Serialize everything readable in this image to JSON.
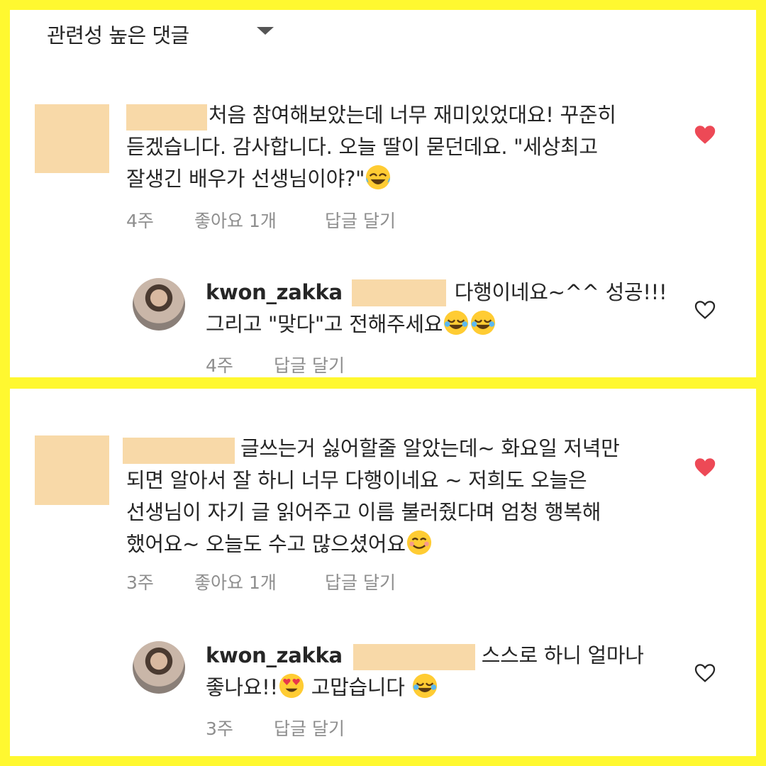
{
  "header": {
    "sort_label": "관련성 높은 댓글"
  },
  "comments": [
    {
      "lines": [
        "처음 참여해보았는데 너무 재미있었대요! 꾸준히",
        "듣겠습니다. 감사합니다. 오늘 딸이 묻던데요. \"세상최고",
        "잘생긴 배우가 선생님이야?\""
      ],
      "time": "4주",
      "likes": "좋아요 1개",
      "reply_label": "답글 달기",
      "liked": true,
      "reply": {
        "username": "kwon_zakka",
        "lines": [
          "다행이네요~^^ 성공!!!",
          "그리고 \"맞다\"고 전해주세요"
        ],
        "time": "4주",
        "reply_label": "답글 달기",
        "liked": false
      }
    },
    {
      "lines": [
        "글쓰는거 싫어할줄 알았는데~ 화요일 저녁만",
        "되면 알아서 잘 하니 너무 다행이네요 ~ 저희도 오늘은",
        "선생님이 자기 글 읽어주고 이름 불러줬다며 엄청 행복해",
        "했어요~ 오늘도 수고 많으셨어요"
      ],
      "time": "3주",
      "likes": "좋아요 1개",
      "reply_label": "답글 달기",
      "liked": true,
      "reply": {
        "username": "kwon_zakka",
        "lines": [
          "스스로 하니 얼마나",
          "좋나요!!",
          "고맙습니다"
        ],
        "time": "3주",
        "reply_label": "답글 달기",
        "liked": false
      }
    }
  ],
  "colors": {
    "heart_liked": "#ED4956",
    "redaction": "#F8D9A8",
    "frame": "#FFF830"
  }
}
